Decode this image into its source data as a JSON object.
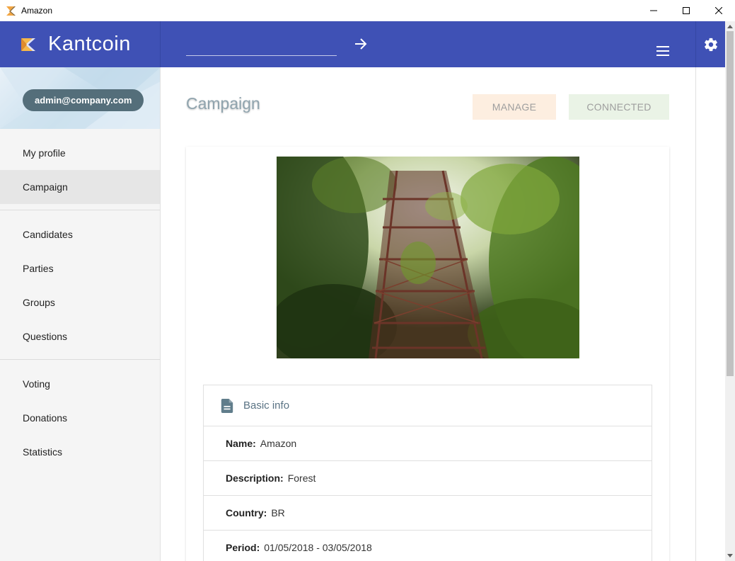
{
  "window": {
    "title": "Amazon"
  },
  "header": {
    "brand": "Kantcoin",
    "search": {
      "value": "",
      "placeholder": ""
    },
    "colors": {
      "primary": "#3f51b5"
    },
    "icons": {
      "go": "arrow-right-icon",
      "menu": "hamburger-menu-icon",
      "settings": "gear-icon"
    }
  },
  "sidebar": {
    "user_email": "admin@company.com",
    "groups": [
      [
        {
          "label": "My profile"
        },
        {
          "label": "Campaign"
        }
      ],
      [
        {
          "label": "Candidates"
        },
        {
          "label": "Parties"
        },
        {
          "label": "Groups"
        },
        {
          "label": "Questions"
        }
      ],
      [
        {
          "label": "Voting"
        },
        {
          "label": "Donations"
        },
        {
          "label": "Statistics"
        }
      ]
    ],
    "active": "Campaign"
  },
  "main": {
    "title": "Campaign",
    "buttons": {
      "manage": "MANAGE",
      "connected": "CONNECTED"
    },
    "basic_info": {
      "heading": "Basic info",
      "rows": [
        {
          "key": "Name:",
          "value": "Amazon"
        },
        {
          "key": "Description:",
          "value": "Forest"
        },
        {
          "key": "Country:",
          "value": "BR"
        },
        {
          "key": "Period:",
          "value": "01/05/2018 - 03/05/2018"
        }
      ]
    }
  }
}
